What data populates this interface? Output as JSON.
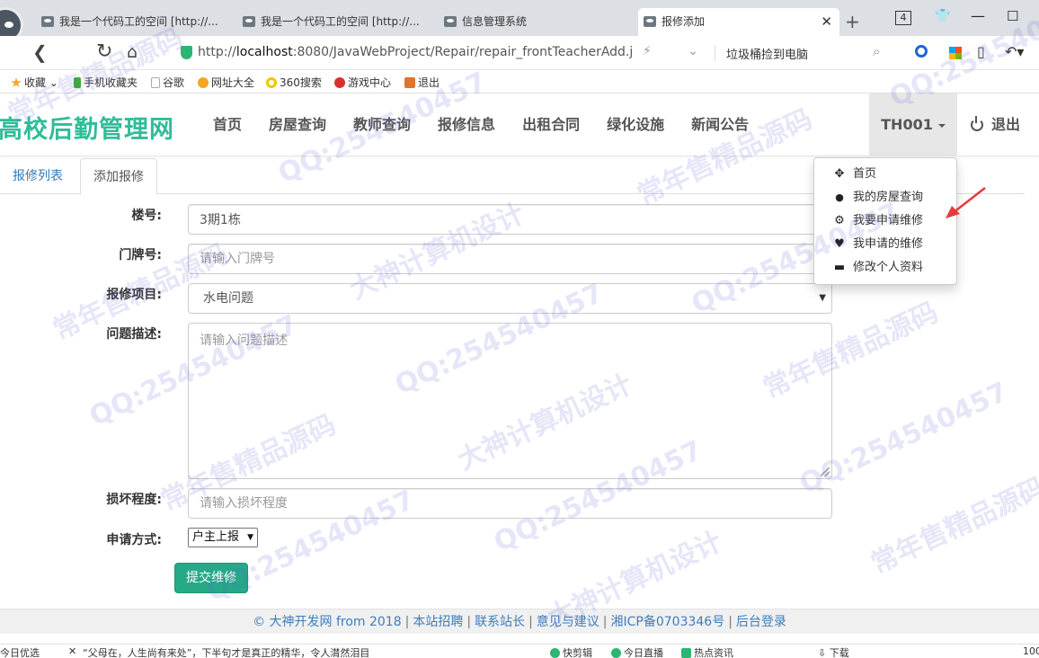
{
  "browser": {
    "tabs": [
      {
        "label": "我是一个代码工的空间 [http://..."
      },
      {
        "label": "我是一个代码工的空间 [http://..."
      },
      {
        "label": "信息管理系统"
      },
      {
        "label": "报修添加",
        "active": true
      }
    ],
    "tab_count": "4",
    "url_prefix": "http://",
    "url_host": "localhost",
    "url_path": ":8080/JavaWebProject/Repair/repair_frontTeacherAdd.jsp",
    "search_hint": "垃圾桶捡到电脑"
  },
  "bookmarks": [
    {
      "label": "收藏",
      "icon": "star-icon",
      "color": "#f5a623"
    },
    {
      "label": "手机收藏夹",
      "icon": "phone-icon",
      "color": "#3cb034"
    },
    {
      "label": "谷歌",
      "icon": "page-icon",
      "color": "#aaaaaa"
    },
    {
      "label": "网址大全",
      "icon": "compass-icon",
      "color": "#f5a623"
    },
    {
      "label": "360搜索",
      "icon": "search360-icon",
      "color": "#f5c400"
    },
    {
      "label": "游戏中心",
      "icon": "game-icon",
      "color": "#d9302c"
    },
    {
      "label": "退出",
      "icon": "exit-icon",
      "color": "#e0742b"
    }
  ],
  "site": {
    "brand": "高校后勤管理网",
    "brand_color": "#2fbd99",
    "nav": [
      "首页",
      "房屋查询",
      "教师查询",
      "报修信息",
      "出租合同",
      "绿化设施",
      "新闻公告"
    ],
    "user": "TH001",
    "logout": "退出"
  },
  "dropdown": {
    "items": [
      {
        "label": "首页",
        "icon": "move-icon",
        "glyph": "✥"
      },
      {
        "label": "我的房屋查询",
        "icon": "user-icon",
        "glyph": "👤"
      },
      {
        "label": "我要申请维修",
        "icon": "cog-icon",
        "glyph": "⚙"
      },
      {
        "label": "我申请的维修",
        "icon": "heart-icon",
        "glyph": "♥"
      },
      {
        "label": "修改个人资料",
        "icon": "credit-card-icon",
        "glyph": "▬"
      }
    ]
  },
  "content_tabs": {
    "list": "报修列表",
    "add": "添加报修"
  },
  "form": {
    "building": {
      "label": "楼号:",
      "value": "3期1栋"
    },
    "door": {
      "label": "门牌号:",
      "placeholder": "请输入门牌号"
    },
    "item": {
      "label": "报修项目:",
      "value": "水电问题"
    },
    "desc": {
      "label": "问题描述:",
      "placeholder": "请输入问题描述"
    },
    "damage": {
      "label": "损坏程度:",
      "placeholder": "请输入损坏程度"
    },
    "method": {
      "label": "申请方式:",
      "value": "户主上报"
    },
    "submit": "提交维修"
  },
  "footer": {
    "copyright": "© 大神开发网 from 2018",
    "links": [
      "本站招聘",
      "联系站长",
      "意见与建议",
      "湘ICP备0703346号",
      "后台登录"
    ]
  },
  "statusbar": {
    "left": "今日优选",
    "news": "“父母在，人生尚有来处”，下半句才是真正的精华，令人潸然泪目",
    "item1": "快剪辑",
    "item2": "今日直播",
    "item3": "热点资讯",
    "download": "下载",
    "zoom": "100"
  },
  "watermarks": [
    "常年售精品源码",
    "QQ:254540457",
    "大神计算机设计"
  ]
}
